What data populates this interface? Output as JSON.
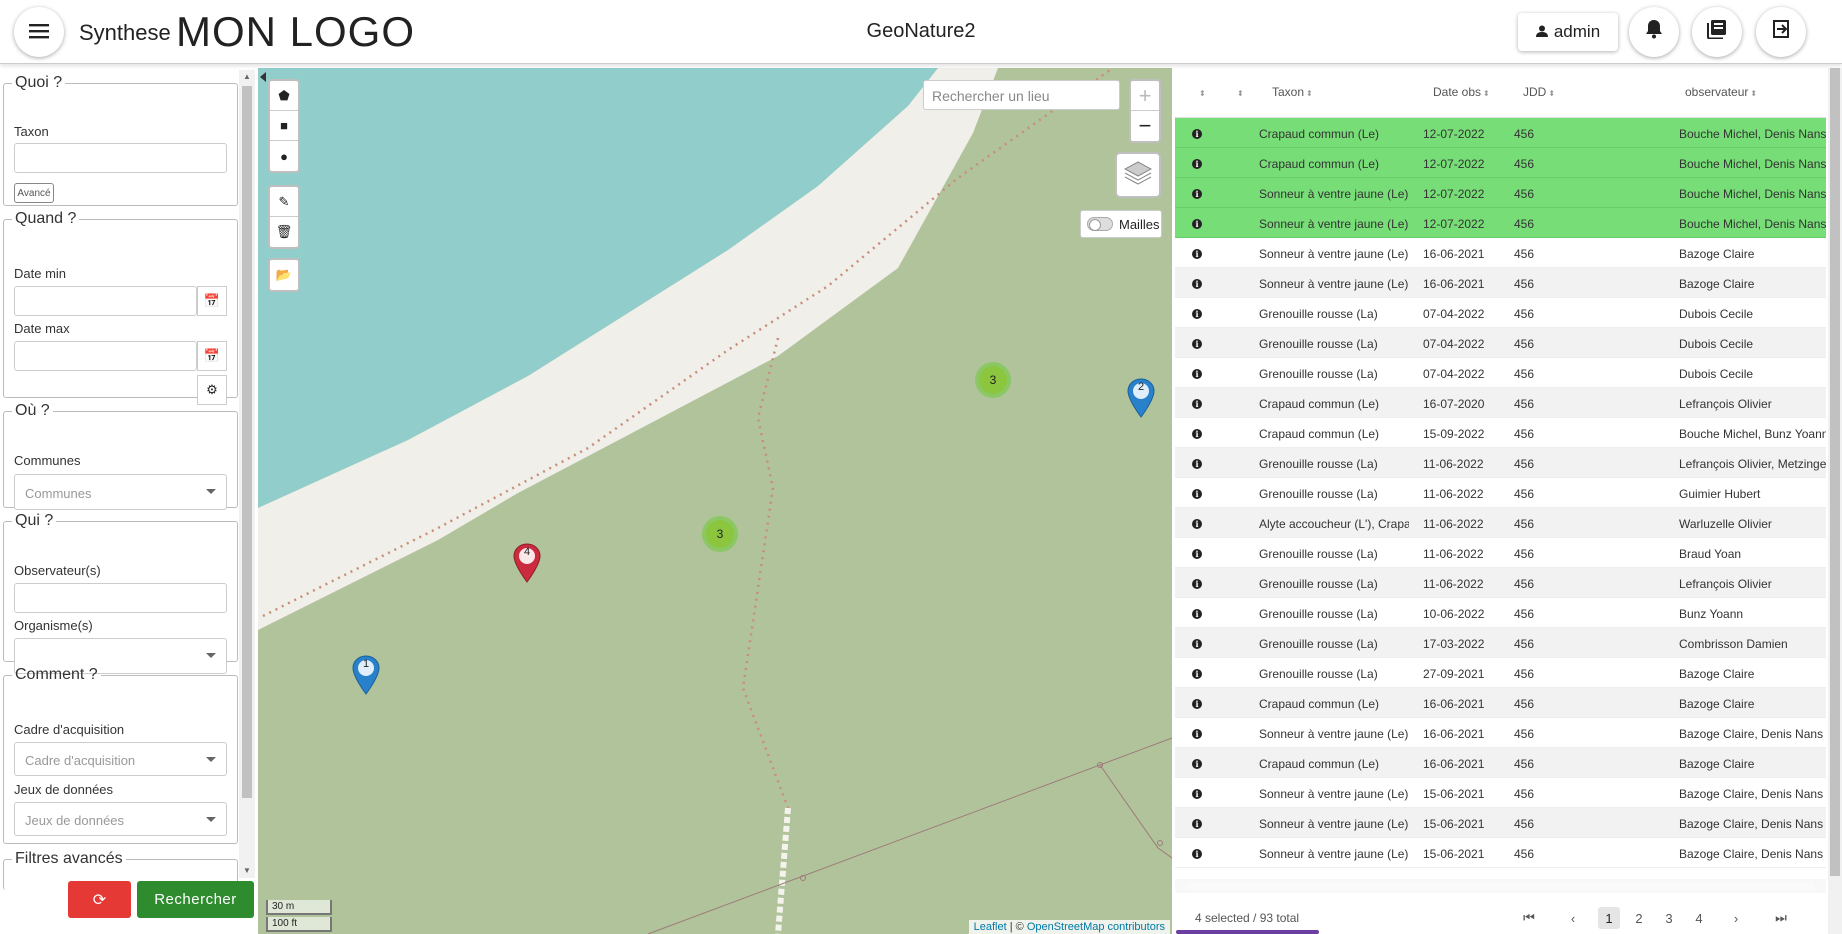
{
  "header": {
    "module": "Synthese",
    "logo": "MON LOGO",
    "app_title": "GeoNature2",
    "user": "admin"
  },
  "filters": {
    "quoi": {
      "legend": "Quoi ?",
      "taxon_label": "Taxon",
      "taxon_value": "",
      "avance_button": "Avancé"
    },
    "quand": {
      "legend": "Quand ?",
      "date_min_label": "Date min",
      "date_max_label": "Date max"
    },
    "ou": {
      "legend": "Où ?",
      "communes_label": "Communes",
      "communes_placeholder": "Communes"
    },
    "qui": {
      "legend": "Qui ?",
      "observateurs_label": "Observateur(s)",
      "organisme_label": "Organisme(s)"
    },
    "comment": {
      "legend": "Comment ?",
      "cadre_label": "Cadre d'acquisition",
      "cadre_placeholder": "Cadre d'acquisition",
      "jdd_label": "Jeux de données",
      "jdd_placeholder": "Jeux de données"
    },
    "avances": {
      "legend": "Filtres avancés"
    },
    "search_button": "Rechercher"
  },
  "map": {
    "search_placeholder": "Rechercher un lieu",
    "zoom_in": "+",
    "zoom_out": "−",
    "mailles_label": "Mailles",
    "clusters": [
      "3",
      "3"
    ],
    "markers": [
      {
        "label": "2",
        "color": "#2a81cb"
      },
      {
        "label": "4",
        "color": "#cb2b3e"
      },
      {
        "label": "1",
        "color": "#2a81cb"
      }
    ],
    "scale_metric": "30 m",
    "scale_imperial": "100 ft",
    "attribution_leaflet": "Leaflet",
    "attribution_sep": " | © ",
    "attribution_osm": "OpenStreetMap contributors"
  },
  "table": {
    "columns": [
      "Taxon",
      "Date obs",
      "JDD",
      "observateur"
    ],
    "rows": [
      {
        "taxon": "Crapaud commun (Le)",
        "date": "12-07-2022",
        "jdd": "456",
        "obs": "Bouche Michel, Denis Nans",
        "selected": true
      },
      {
        "taxon": "Crapaud commun (Le)",
        "date": "12-07-2022",
        "jdd": "456",
        "obs": "Bouche Michel, Denis Nans",
        "selected": true
      },
      {
        "taxon": "Sonneur à ventre jaune (Le)",
        "date": "12-07-2022",
        "jdd": "456",
        "obs": "Bouche Michel, Denis Nans",
        "selected": true
      },
      {
        "taxon": "Sonneur à ventre jaune (Le)",
        "date": "12-07-2022",
        "jdd": "456",
        "obs": "Bouche Michel, Denis Nans",
        "selected": true
      },
      {
        "taxon": "Sonneur à ventre jaune (Le)",
        "date": "16-06-2021",
        "jdd": "456",
        "obs": "Bazoge Claire",
        "selected": false
      },
      {
        "taxon": "Sonneur à ventre jaune (Le)",
        "date": "16-06-2021",
        "jdd": "456",
        "obs": "Bazoge Claire",
        "selected": false
      },
      {
        "taxon": "Grenouille rousse (La)",
        "date": "07-04-2022",
        "jdd": "456",
        "obs": "Dubois Cecile",
        "selected": false
      },
      {
        "taxon": "Grenouille rousse (La)",
        "date": "07-04-2022",
        "jdd": "456",
        "obs": "Dubois Cecile",
        "selected": false
      },
      {
        "taxon": "Grenouille rousse (La)",
        "date": "07-04-2022",
        "jdd": "456",
        "obs": "Dubois Cecile",
        "selected": false
      },
      {
        "taxon": "Crapaud commun (Le)",
        "date": "16-07-2020",
        "jdd": "456",
        "obs": "Lefrançois Olivier",
        "selected": false
      },
      {
        "taxon": "Crapaud commun (Le)",
        "date": "15-09-2022",
        "jdd": "456",
        "obs": "Bouche Michel, Bunz Yoann",
        "selected": false
      },
      {
        "taxon": "Grenouille rousse (La)",
        "date": "11-06-2022",
        "jdd": "456",
        "obs": "Lefrançois Olivier, Metzinger",
        "selected": false
      },
      {
        "taxon": "Grenouille rousse (La)",
        "date": "11-06-2022",
        "jdd": "456",
        "obs": "Guimier Hubert",
        "selected": false
      },
      {
        "taxon": "Alyte accoucheur (L'), Crapaud",
        "date": "11-06-2022",
        "jdd": "456",
        "obs": "Warluzelle Olivier",
        "selected": false
      },
      {
        "taxon": "Grenouille rousse (La)",
        "date": "11-06-2022",
        "jdd": "456",
        "obs": "Braud Yoan",
        "selected": false
      },
      {
        "taxon": "Grenouille rousse (La)",
        "date": "11-06-2022",
        "jdd": "456",
        "obs": "Lefrançois Olivier",
        "selected": false
      },
      {
        "taxon": "Grenouille rousse (La)",
        "date": "10-06-2022",
        "jdd": "456",
        "obs": "Bunz Yoann",
        "selected": false
      },
      {
        "taxon": "Grenouille rousse (La)",
        "date": "17-03-2022",
        "jdd": "456",
        "obs": "Combrisson Damien",
        "selected": false
      },
      {
        "taxon": "Grenouille rousse (La)",
        "date": "27-09-2021",
        "jdd": "456",
        "obs": "Bazoge Claire",
        "selected": false
      },
      {
        "taxon": "Crapaud commun (Le)",
        "date": "16-06-2021",
        "jdd": "456",
        "obs": "Bazoge Claire",
        "selected": false
      },
      {
        "taxon": "Sonneur à ventre jaune (Le)",
        "date": "16-06-2021",
        "jdd": "456",
        "obs": "Bazoge Claire, Denis Nans",
        "selected": false
      },
      {
        "taxon": "Crapaud commun (Le)",
        "date": "16-06-2021",
        "jdd": "456",
        "obs": "Bazoge Claire",
        "selected": false
      },
      {
        "taxon": "Sonneur à ventre jaune (Le)",
        "date": "15-06-2021",
        "jdd": "456",
        "obs": "Bazoge Claire, Denis Nans",
        "selected": false
      },
      {
        "taxon": "Sonneur à ventre jaune (Le)",
        "date": "15-06-2021",
        "jdd": "456",
        "obs": "Bazoge Claire, Denis Nans",
        "selected": false
      },
      {
        "taxon": "Sonneur à ventre jaune (Le)",
        "date": "15-06-2021",
        "jdd": "456",
        "obs": "Bazoge Claire, Denis Nans",
        "selected": false
      }
    ],
    "summary": "4 selected / 93 total",
    "pages": [
      "1",
      "2",
      "3",
      "4"
    ],
    "current_page": "1"
  },
  "colors": {
    "selected_row": "#77dd77",
    "search_button": "#2e8b2e",
    "reset_button": "#e53935",
    "water": "#91cdca",
    "land": "#b0c39b"
  }
}
